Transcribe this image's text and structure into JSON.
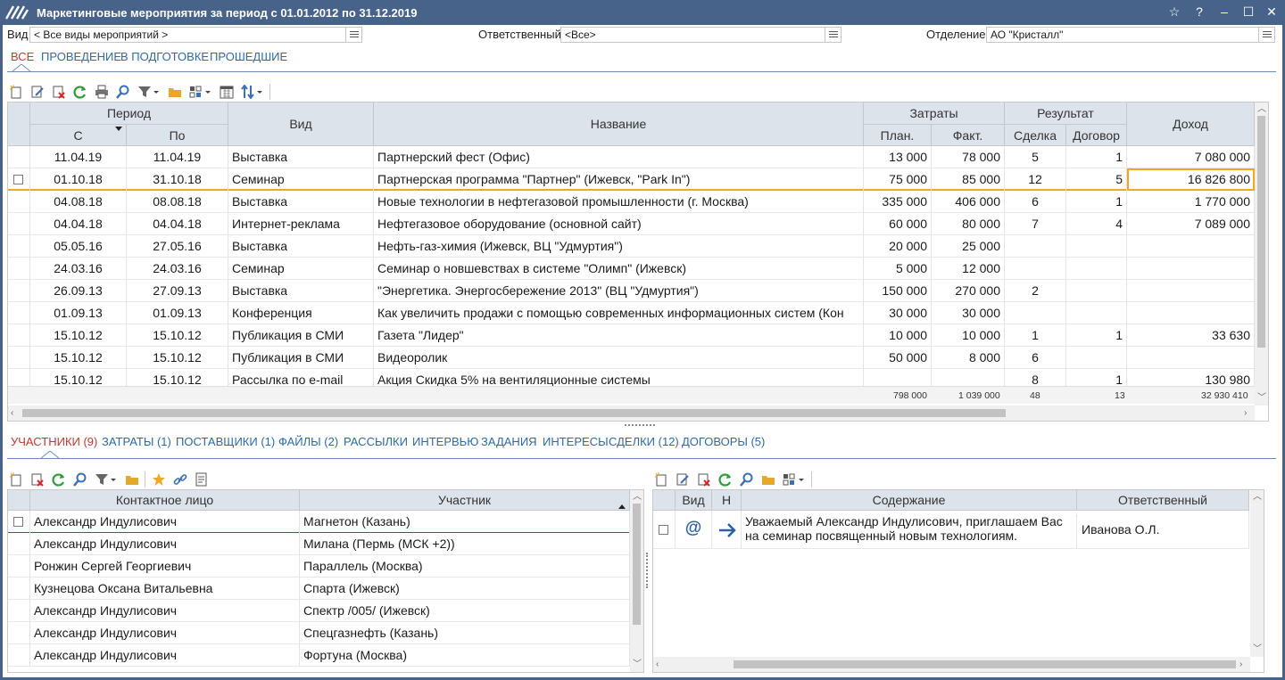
{
  "window": {
    "title": "Маркетинговые мероприятия за период с 01.01.2012 по 31.12.2019",
    "buttons": [
      "☆",
      "?",
      "–",
      "☐",
      "✕"
    ]
  },
  "filters": {
    "vid_label": "Вид",
    "vid_value": "< Все виды мероприятий >",
    "resp_label": "Ответственный",
    "resp_value": "<Все>",
    "dept_label": "Отделение",
    "dept_value": "АО \"Кристалл\""
  },
  "top_tabs": [
    "ВСЕ",
    "ПРОВЕДЕНИЕ",
    "В ПОДГОТОВКЕ",
    "ПРОШЕДШИЕ"
  ],
  "main_table": {
    "group_period": "Период",
    "col_from": "С",
    "col_to": "По",
    "col_type": "Вид",
    "col_name": "Название",
    "group_costs": "Затраты",
    "col_plan": "План.",
    "col_fact": "Факт.",
    "group_result": "Результат",
    "col_deal": "Сделка",
    "col_contract": "Договор",
    "col_income": "Доход",
    "rows": [
      {
        "from": "11.04.19",
        "to": "11.04.19",
        "type": "Выставка",
        "name": "Партнерский фест (Офис)",
        "plan": "13 000",
        "fact": "78 000",
        "deal": "5",
        "contract": "1",
        "income": "7 080 000"
      },
      {
        "from": "01.10.18",
        "to": "31.10.18",
        "type": "Семинар",
        "name": "Партнерская программа \"Партнер\" (Ижевск, \"Park In\")",
        "plan": "75 000",
        "fact": "85 000",
        "deal": "12",
        "contract": "5",
        "income": "16 826 800"
      },
      {
        "from": "04.08.18",
        "to": "08.08.18",
        "type": "Выставка",
        "name": "Новые технологии в нефтегазовой промышленности (г. Москва)",
        "plan": "335 000",
        "fact": "406 000",
        "deal": "6",
        "contract": "1",
        "income": "1 770 000"
      },
      {
        "from": "04.04.18",
        "to": "04.04.18",
        "type": "Интернет-реклама",
        "name": "Нефтегазовое оборудование (основной сайт)",
        "plan": "60 000",
        "fact": "80 000",
        "deal": "7",
        "contract": "4",
        "income": "7 089 000"
      },
      {
        "from": "05.05.16",
        "to": "27.05.16",
        "type": "Выставка",
        "name": "Нефть-газ-химия (Ижевск, ВЦ \"Удмуртия\")",
        "plan": "20 000",
        "fact": "25 000",
        "deal": "",
        "contract": "",
        "income": ""
      },
      {
        "from": "24.03.16",
        "to": "24.03.16",
        "type": "Семинар",
        "name": "Семинар о новшевствах в системе \"Олимп\" (Ижевск)",
        "plan": "5 000",
        "fact": "12 000",
        "deal": "",
        "contract": "",
        "income": ""
      },
      {
        "from": "26.09.13",
        "to": "27.09.13",
        "type": "Выставка",
        "name": "\"Энергетика. Энергосбережение 2013\" (ВЦ \"Удмуртия\")",
        "plan": "150 000",
        "fact": "270 000",
        "deal": "2",
        "contract": "",
        "income": ""
      },
      {
        "from": "01.09.13",
        "to": "01.09.13",
        "type": "Конференция",
        "name": "Как увеличить продажи с помощью современных  информационных систем (Кон",
        "plan": "30 000",
        "fact": "30 000",
        "deal": "",
        "contract": "",
        "income": ""
      },
      {
        "from": "15.10.12",
        "to": "15.10.12",
        "type": "Публикация в СМИ",
        "name": "Газета \"Лидер\"",
        "plan": "10 000",
        "fact": "10 000",
        "deal": "1",
        "contract": "1",
        "income": "33 630"
      },
      {
        "from": "15.10.12",
        "to": "15.10.12",
        "type": "Публикация в СМИ",
        "name": "Видеоролик",
        "plan": "50 000",
        "fact": "8 000",
        "deal": "6",
        "contract": "",
        "income": ""
      },
      {
        "from": "15.10.12",
        "to": "15.10.12",
        "type": "Рассылка по e-mail",
        "name": "Акция Скидка 5% на вентиляционные системы",
        "plan": "",
        "fact": "",
        "deal": "8",
        "contract": "1",
        "income": "130 980"
      }
    ],
    "totals": {
      "plan": "798 000",
      "fact": "1 039 000",
      "deal": "48",
      "contract": "13",
      "income": "32 930 410"
    }
  },
  "bottom_tabs": [
    "УЧАСТНИКИ (9)",
    "ЗАТРАТЫ (1)",
    "ПОСТАВЩИКИ (1)",
    "ФАЙЛЫ (2)",
    "РАССЫЛКИ",
    "ИНТЕРВЬЮ",
    "ЗАДАНИЯ",
    "ИНТЕРЕСЫ",
    "СДЕЛКИ (12)",
    "ДОГОВОРЫ (5)"
  ],
  "participants": {
    "col_contact": "Контактное лицо",
    "col_participant": "Участник",
    "rows": [
      {
        "contact": "Александр Индулисович",
        "participant": "Магнетон (Казань)"
      },
      {
        "contact": "Александр Индулисович",
        "participant": "Милана (Пермь (МСК +2))"
      },
      {
        "contact": "Ронжин Сергей Георгиевич",
        "participant": "Параллель (Москва)"
      },
      {
        "contact": "Кузнецова Оксана Витальевна",
        "participant": "Спарта (Ижевск)"
      },
      {
        "contact": "Александр Индулисович",
        "participant": "Спектр /005/ (Ижевск)"
      },
      {
        "contact": "Александр Индулисович",
        "participant": "Спецгазнефть (Казань)"
      },
      {
        "contact": "Александр Индулисович",
        "participant": "Фортуна (Москва)"
      }
    ]
  },
  "messages": {
    "col_type": "Вид",
    "col_dir": "Н",
    "col_content": "Содержание",
    "col_resp": "Ответственный",
    "rows": [
      {
        "type_icon": "at-icon",
        "dir_icon": "arrow-right-icon",
        "content_line1": "Уважаемый Александр Индулисович, приглашаем Вас",
        "content_line2": "на семинар посвященный новым технологиям.",
        "resp": "Иванова О.Л."
      }
    ]
  },
  "colors": {
    "title_bar": "#47638a",
    "accent_tab": "#c0392b",
    "link_tab": "#2a6aa8",
    "header_bg": "#dde3ea",
    "selected_row_border": "#f0a81e"
  }
}
